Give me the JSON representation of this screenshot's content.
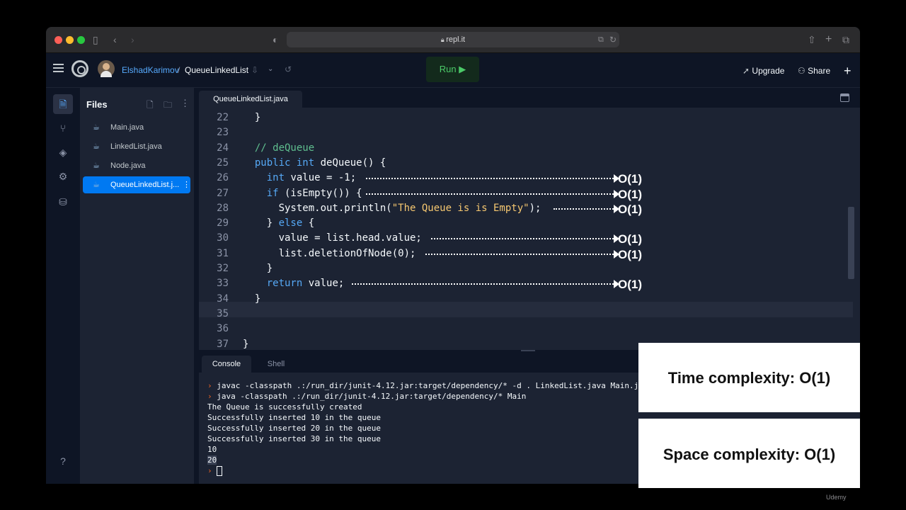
{
  "browser": {
    "url": "repl.it"
  },
  "header": {
    "username": "ElshadKarimov",
    "separator": "/",
    "repl_name": "QueueLinkedList",
    "run_label": "Run ▶",
    "upgrade_label": "Upgrade",
    "share_label": "Share"
  },
  "files": {
    "title": "Files",
    "items": [
      "Main.java",
      "LinkedList.java",
      "Node.java",
      "QueueLinkedList.j..."
    ],
    "active_index": 3
  },
  "editor": {
    "tab": "QueueLinkedList.java",
    "lines": [
      {
        "n": "22",
        "t": "  }"
      },
      {
        "n": "23",
        "t": ""
      },
      {
        "n": "24",
        "t": "  // deQueue"
      },
      {
        "n": "25",
        "t": "  public int deQueue() {"
      },
      {
        "n": "26",
        "t": "    int value = -1;"
      },
      {
        "n": "27",
        "t": "    if (isEmpty()) {"
      },
      {
        "n": "28",
        "t": "      System.out.println(\"The Queue is is Empty\");"
      },
      {
        "n": "29",
        "t": "    } else {"
      },
      {
        "n": "30",
        "t": "      value = list.head.value;"
      },
      {
        "n": "31",
        "t": "      list.deletionOfNode(0);"
      },
      {
        "n": "32",
        "t": "    }"
      },
      {
        "n": "33",
        "t": "    return value;"
      },
      {
        "n": "34",
        "t": "  }"
      },
      {
        "n": "35",
        "t": ""
      },
      {
        "n": "36",
        "t": ""
      },
      {
        "n": "37",
        "t": "}"
      }
    ],
    "annotation": "O(1)"
  },
  "console": {
    "tabs": [
      "Console",
      "Shell"
    ],
    "lines": [
      "javac -classpath .:/run_dir/junit-4.12.jar:target/dependency/* -d . LinkedList.java Main.java N",
      "java -classpath .:/run_dir/junit-4.12.jar:target/dependency/* Main",
      "The Queue is successfully created",
      "Successfully inserted 10 in the queue",
      "Successfully inserted 20 in the queue",
      "Successfully inserted 30 in the queue",
      "10",
      "20"
    ]
  },
  "overlay": {
    "time": "Time complexity: O(1)",
    "space": "Space complexity: O(1)"
  },
  "watermark": "Udemy",
  "colors": {
    "run_green": "#4bca68",
    "active_file": "#0079f2",
    "keyword": "#56a9f6",
    "comment": "#5fbf8f",
    "string": "#f5c770"
  }
}
